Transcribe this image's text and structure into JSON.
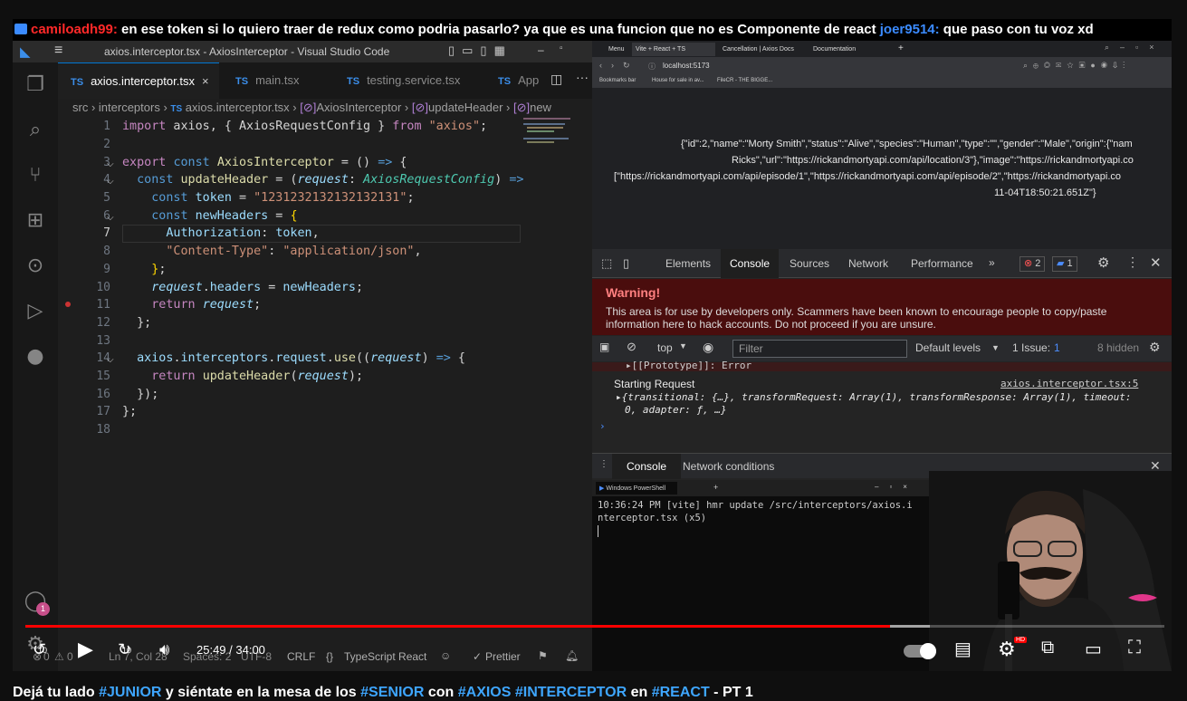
{
  "chat": {
    "user1": "camiloadh99:",
    "msg1": " en ese token si lo quiero traer de redux como podria pasarlo? ya que es una funcion que no es Componente de react ",
    "user2": "joer9514:",
    "msg2": " que paso con tu voz xd"
  },
  "vscode": {
    "window_title": "axios.interceptor.tsx - AxiosInterceptor - Visual Studio Code",
    "tabs": [
      {
        "lang": "TS",
        "label": "axios.interceptor.tsx",
        "close": "×"
      },
      {
        "lang": "TS",
        "label": "main.tsx"
      },
      {
        "lang": "TS",
        "label": "testing.service.tsx"
      },
      {
        "lang": "TS",
        "label": "App"
      }
    ],
    "breadcrumb": [
      "src",
      "interceptors",
      "axios.interceptor.tsx",
      "AxiosInterceptor",
      "updateHeader",
      "new"
    ],
    "breadcrumb_lang": "TS",
    "line_numbers": [
      "1",
      "2",
      "3",
      "4",
      "5",
      "6",
      "7",
      "8",
      "9",
      "10",
      "11",
      "12",
      "13",
      "14",
      "15",
      "16",
      "17",
      "18"
    ],
    "badge": "1",
    "status": {
      "errors": "0",
      "warnings": "0",
      "cursor": "Ln 7, Col 28",
      "spaces": "Spaces: 2",
      "encoding": "UTF-8",
      "eol": "CRLF",
      "lang": "TypeScript React",
      "prettier": "Prettier"
    }
  },
  "browser": {
    "tabs": [
      "Menu",
      "Vite + React + TS",
      "Cancellation | Axios Docs",
      "Documentation"
    ],
    "url": "localhost:5173",
    "bookmarks": [
      "Bookmarks bar",
      "House for sale in av...",
      "FileCR - THE BIGGE..."
    ],
    "json_lines": [
      "{\"id\":2,\"name\":\"Morty Smith\",\"status\":\"Alive\",\"species\":\"Human\",\"type\":\"\",\"gender\":\"Male\",\"origin\":{\"nam",
      "Ricks\",\"url\":\"https://rickandmortyapi.com/api/location/3\"},\"image\":\"https://rickandmortyapi.co",
      "[\"https://rickandmortyapi.com/api/episode/1\",\"https://rickandmortyapi.com/api/episode/2\",\"https://rickandmortyapi.co",
      "11-04T18:50:21.651Z\"}"
    ]
  },
  "devtools": {
    "tabs": [
      "Elements",
      "Console",
      "Sources",
      "Network",
      "Performance"
    ],
    "errors": "2",
    "messages": "1",
    "warning_title": "Warning!",
    "warning_text": "This area is for use by developers only. Scammers have been known to encourage people to copy/paste information here to hack accounts. Do not proceed if you are unsure.",
    "context": "top",
    "filter_placeholder": "Filter",
    "levels": "Default levels",
    "issues_label": "1 Issue:",
    "issues_count": "1",
    "hidden": "8 hidden",
    "log_proto": "▸[[Prototype]]: Error",
    "log_start": "Starting Request",
    "log_source": "axios.interceptor.tsx:5",
    "log_obj1": "▸{transitional: {…}, transformRequest: Array(1), transformResponse: Array(1), timeout:",
    "log_obj2": "0, adapter: ƒ, …}",
    "drawer_tabs": [
      "Console",
      "Network conditions"
    ]
  },
  "terminal": {
    "title": "Windows PowerShell",
    "line1": "10:36:24 PM [vite] hmr update /src/interceptors/axios.i",
    "line2": "nterceptor.tsx (x5)"
  },
  "player": {
    "time": "25:49 / 34:00",
    "progress_fraction": 0.759,
    "skip": "10"
  },
  "video_title": {
    "parts": [
      "Dejá tu lado ",
      "#JUNIOR",
      " y siéntate en la mesa de los ",
      "#SENIOR",
      " con ",
      "#AXIOS",
      " ",
      "#INTERCEPTOR",
      " en ",
      "#REACT",
      " - PT 1"
    ]
  }
}
